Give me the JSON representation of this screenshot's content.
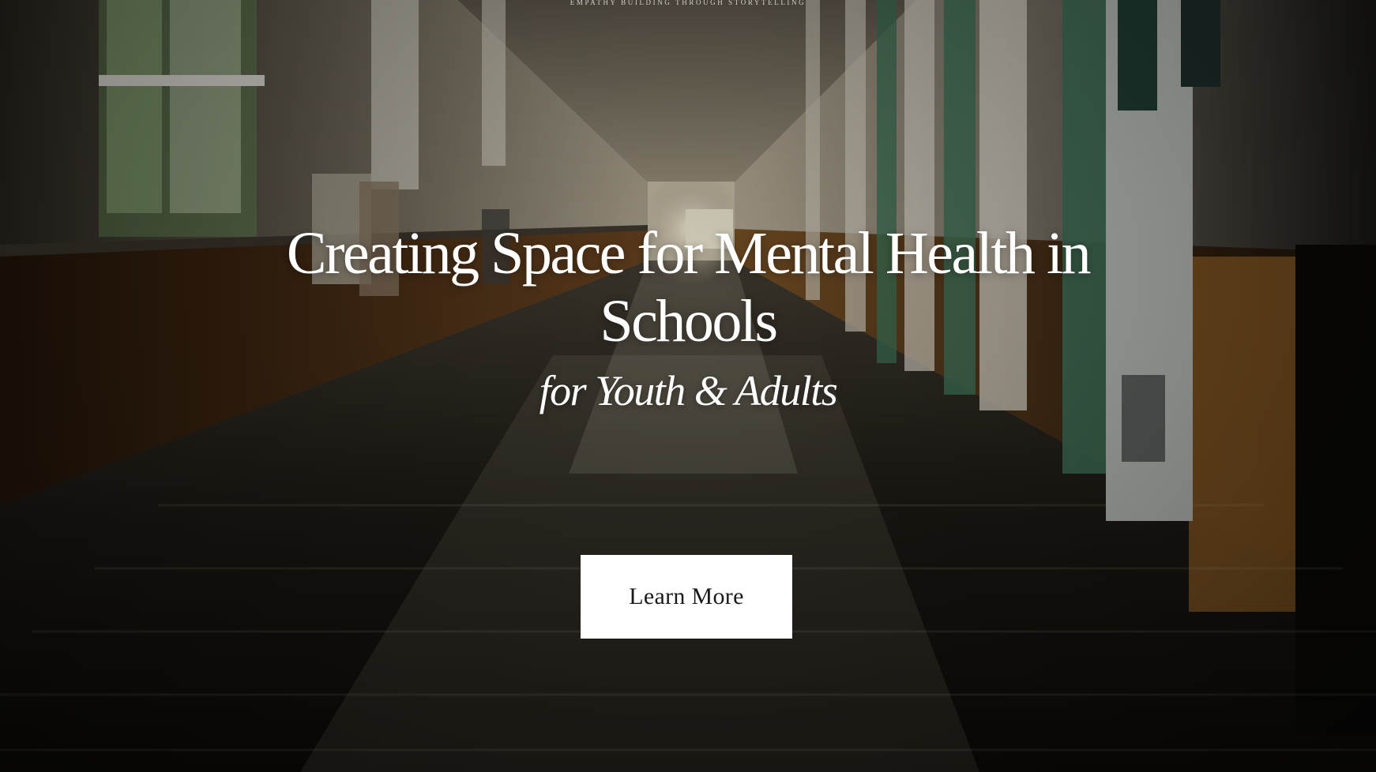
{
  "hero": {
    "tagline": "EMPATHY BUILDING THROUGH STORYTELLING",
    "title": "Creating Space for Mental Health in Schools",
    "subtitle": "for Youth & Adults",
    "cta_label": "Learn More"
  },
  "colors": {
    "text": "#ffffff",
    "button_bg": "#ffffff",
    "button_text": "#1a1a1a"
  }
}
